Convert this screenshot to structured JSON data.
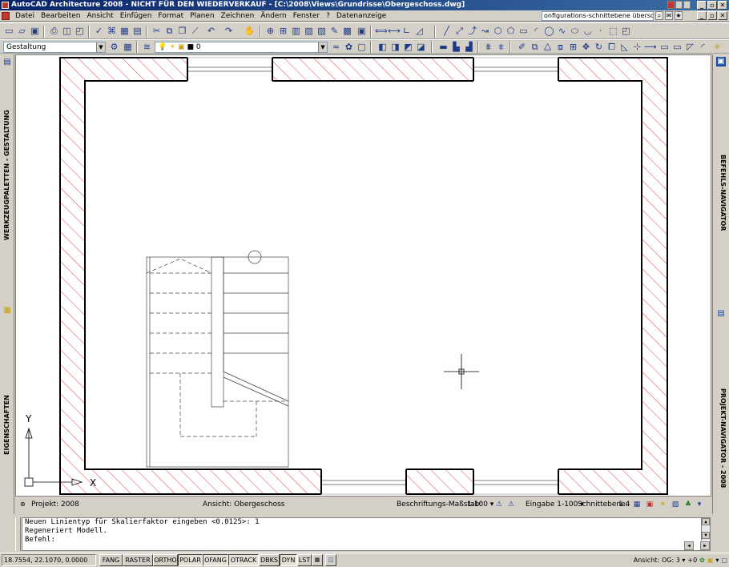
{
  "window": {
    "title": "AutoCAD Architecture 2008 - NICHT FÜR DEN WIEDERVERKAUF - [C:\\2008\\Views\\Grundrisse\\Obergeschoss.dwg]",
    "buttons": [
      "_",
      "▫",
      "✕"
    ]
  },
  "menu": {
    "items": [
      "Datei",
      "Bearbeiten",
      "Ansicht",
      "Einfügen",
      "Format",
      "Planen",
      "Zeichnen",
      "Ändern",
      "Fenster",
      "?",
      "Datenanzeige"
    ],
    "search_value": "onfigurations-schnittebene überschreiben",
    "doc_buttons": [
      "_",
      "▫",
      "✕"
    ]
  },
  "toolbar2": {
    "workspace": "Gestaltung",
    "layer": "0"
  },
  "palettes": {
    "left_top": "WERKZEUGPALETTEN - GESTALTUNG",
    "left_bottom": "EIGENSCHAFTEN",
    "right_top": "BEFEHLS-NAVIGATOR",
    "right_bottom": "PROJEKT-NAVIGATOR - 2008"
  },
  "drawing": {
    "ucs_y": "Y",
    "ucs_x": "X"
  },
  "drawing_status": {
    "project": "Projekt: 2008",
    "view": "Ansicht: Obergeschoss",
    "scale_label": "Beschriftungs-Maßstab:",
    "scale_value": "1:100",
    "input": "Eingabe 1-100",
    "cut_plane_label": "Schnittebene:",
    "cut_plane_value": "1.4"
  },
  "command": {
    "lines": [
      "Neuen Linientyp für Skalierfaktor eingeben <0.0125>: 1",
      "Regeneriert Modell."
    ],
    "prompt": "Befehl:"
  },
  "statusbar": {
    "coordinates": "18.7554, 22.1070, 0.0000",
    "modes": [
      "FANG",
      "RASTER",
      "ORTHO",
      "POLAR",
      "OFANG",
      "OTRACK",
      "DBKS",
      "DYN",
      "LST"
    ],
    "view_label": "Ansicht:",
    "floor": "OG: 3",
    "elevation": "+0"
  },
  "colors": {
    "hatch": "#e03030",
    "wall": "#000000",
    "title_start": "#0a246a",
    "title_end": "#3a6ea5"
  }
}
